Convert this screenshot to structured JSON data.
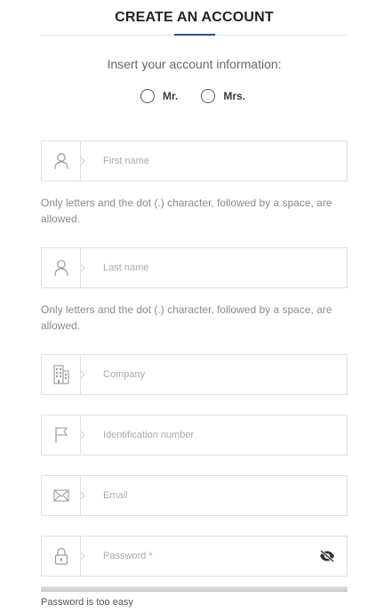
{
  "header": {
    "title": "CREATE AN ACCOUNT"
  },
  "subtitle": "Insert your account information:",
  "gender": {
    "options": [
      {
        "label": "Mr.",
        "selected": false
      },
      {
        "label": "Mrs.",
        "selected": false
      }
    ]
  },
  "fields": {
    "first_name": {
      "placeholder": "First name",
      "icon": "user-icon"
    },
    "last_name": {
      "placeholder": "Last name",
      "icon": "user-icon"
    },
    "company": {
      "placeholder": "Company",
      "icon": "building-icon"
    },
    "identification": {
      "placeholder": "Identification number",
      "icon": "flag-icon"
    },
    "email": {
      "placeholder": "Email",
      "icon": "envelope-icon"
    },
    "password": {
      "placeholder": "Password *",
      "icon": "lock-icon",
      "toggle_icon": "eye-slash-icon"
    }
  },
  "hints": {
    "first_name": "Only letters and the dot (.) character, followed by a space, are allowed.",
    "last_name": "Only letters and the dot (.) character, followed by a space, are allowed."
  },
  "password_strength": {
    "text": "Password is too easy",
    "level": 0.0
  },
  "colors": {
    "accent": "#2a5580",
    "border": "#e0e0e0",
    "icon": "#9a9a9a"
  }
}
